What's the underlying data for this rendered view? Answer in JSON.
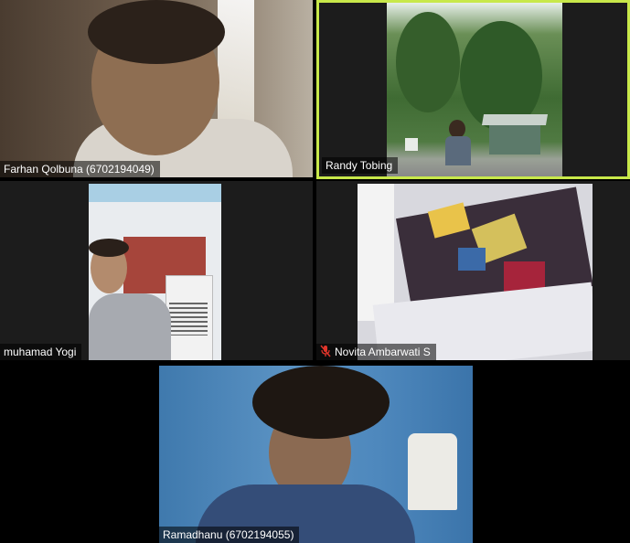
{
  "participants": [
    {
      "name": "Farhan Qolbuna (6702194049)"
    },
    {
      "name": "Randy Tobing"
    },
    {
      "name": "muhamad Yogi"
    },
    {
      "name": "Novita Ambarwati S",
      "mic_muted": true
    },
    {
      "name": "Ramadhanu (6702194055)"
    }
  ],
  "colors": {
    "active_speaker_border": "#c8e84a",
    "muted_icon": "#e0352b",
    "tile_background": "#1c1c1c"
  },
  "icons": {
    "muted": "mic-muted-icon"
  }
}
